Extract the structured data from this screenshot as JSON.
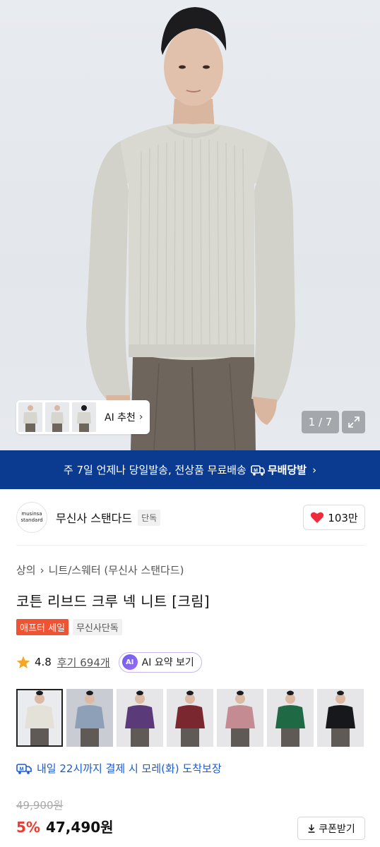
{
  "gallery": {
    "counter": "1 / 7",
    "ai_recommend_label": "AI 추천",
    "thumbnails": [
      "model-front",
      "model-side",
      "model-back"
    ]
  },
  "banner": {
    "text": "주 7일 언제나 당일발송, 전상품 무료배송",
    "brand_label": "무배당발",
    "color": "#0a3b91"
  },
  "brand": {
    "logo_line1": "musinsa",
    "logo_line2": "standard",
    "name": "무신사 스탠다드",
    "tag": "단독",
    "likes": "103만"
  },
  "product": {
    "breadcrumb": [
      "상의",
      "니트/스웨터 (무신사 스탠다드)"
    ],
    "title": "코튼 리브드 크루 넥 니트 [크림]",
    "tags": [
      "애프터 세일",
      "무신사단독"
    ],
    "rating": "4.8",
    "reviews": "후기 694개",
    "ai_summary": "AI 요약 보기",
    "ai_badge": "AI"
  },
  "colors": [
    "#e3e1d8",
    "#8ea0b8",
    "#5a3a78",
    "#7a2730",
    "#c48b93",
    "#1f6a45",
    "#17181c"
  ],
  "delivery": {
    "text": "내일 22시까지 결제 시 모레(화) 도착보장"
  },
  "price": {
    "original": "49,900원",
    "discount": "5%",
    "final": "47,490원",
    "coupon": "쿠폰받기"
  }
}
